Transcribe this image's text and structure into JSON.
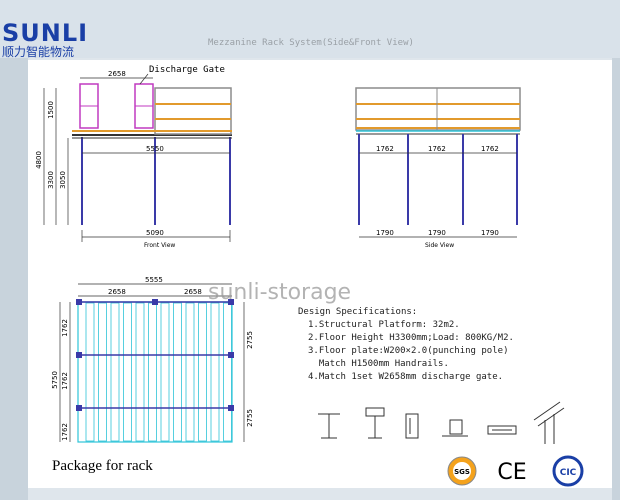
{
  "logo": {
    "text": "SUNLI",
    "subtitle": "顺力智能物流"
  },
  "drawing_title": "Mezzanine Rack System(Side&Front View)",
  "front_view": {
    "label": "Front View",
    "discharge_gate": "Discharge Gate",
    "dim_gate": "2658",
    "dim_span": "5550",
    "dim_base": "5090",
    "dim_total_height": "4800",
    "dim_rail": "1500",
    "dim_floor": "3300",
    "dim_column": "3050"
  },
  "side_view": {
    "label": "Side View",
    "dims_top": [
      "1762",
      "1762",
      "1762"
    ],
    "dims_bottom": [
      "1790",
      "1790",
      "1790"
    ]
  },
  "plan_view": {
    "dim_total": "5555",
    "dim_left": "2658",
    "dim_right": "2658",
    "dim_depth": "5750",
    "dims_left_side": [
      "1762",
      "1762",
      "1762"
    ],
    "dims_right_side": [
      "2755",
      "2755"
    ]
  },
  "watermark": "sunli-storage",
  "specs": {
    "title": "Design Specifications:",
    "items": [
      "1.Structural Platform: 32m2.",
      "2.Floor Height H3300mm;Load: 800KG/M2.",
      "3.Floor plate:W200×2.0(punching pole)",
      "  Match H1500mm Handrails.",
      "4.Match 1set W2658mm discharge gate."
    ]
  },
  "caption": "Package for rack",
  "certifications": [
    "SGS",
    "CE",
    "CIC"
  ],
  "colors": {
    "column": "#3a3aa8",
    "beam": "#e29a2c",
    "handrail": "#8c8c8c",
    "gate": "#c03ac0",
    "deck": "#2ec4d8",
    "brand": "#1a3fa6"
  }
}
